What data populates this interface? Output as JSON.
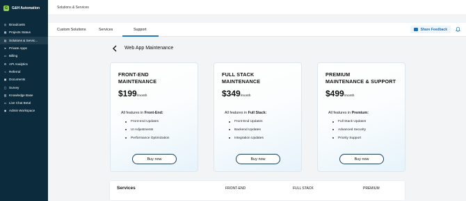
{
  "sidebar": {
    "brand": "G&H Automation",
    "brand_initial": "G",
    "items": [
      {
        "label": "Broadcasts",
        "icon": "broadcast-icon"
      },
      {
        "label": "Projects Status",
        "icon": "projects-icon"
      },
      {
        "label": "Solutions & Servic...",
        "icon": "solutions-icon"
      },
      {
        "label": "Private Apps",
        "icon": "apps-icon"
      },
      {
        "label": "Billing",
        "icon": "billing-icon"
      },
      {
        "label": "API Analytics",
        "icon": "analytics-icon"
      },
      {
        "label": "Referral",
        "icon": "referral-icon"
      },
      {
        "label": "Documents",
        "icon": "documents-icon"
      },
      {
        "label": "Survey",
        "icon": "survey-icon"
      },
      {
        "label": "Knowledge Base",
        "icon": "knowledge-icon"
      },
      {
        "label": "Live Chat Betal",
        "icon": "chat-icon"
      },
      {
        "label": "Admin Workspace",
        "icon": "admin-icon"
      }
    ]
  },
  "header": {
    "breadcrumb": "Solutions & Services"
  },
  "tabs": [
    {
      "label": "Custom Solutions"
    },
    {
      "label": "Services"
    },
    {
      "label": "Support"
    }
  ],
  "actions": {
    "share_feedback": "Share Feedback"
  },
  "page": {
    "title": "Web App Maintenance"
  },
  "cards": [
    {
      "title_line1": "FRONT-END",
      "title_line2": "MAINTENANCE",
      "price": "$199",
      "period": "/month",
      "features_prefix": "All features in ",
      "features_tier": "Front-End:",
      "features": [
        "Front-end Updates",
        "UI Adjustments",
        "Performance Optimization"
      ],
      "button": "Buy now"
    },
    {
      "title_line1": "FULL STACK",
      "title_line2": "MAINTENANCE",
      "price": "$349",
      "period": "/month",
      "features_prefix": "All features in ",
      "features_tier": "Full Stack:",
      "features": [
        "Front-End Updates",
        "Backend Updates",
        "Integration Updates"
      ],
      "button": "Buy now"
    },
    {
      "title_line1": "PREMIUM",
      "title_line2": "MAINTENANCE & SUPPORT",
      "price": "$499",
      "period": "/month",
      "features_prefix": "All features in ",
      "features_tier": "Premium:",
      "features": [
        "Full Stack Updates",
        "Advanced Security",
        "Priority Support"
      ],
      "button": "Buy now"
    }
  ],
  "compare": {
    "services": "Services",
    "col1": "FRONT-END",
    "col2": "FULL STACK",
    "col3": "PREMIUM"
  },
  "colors": {
    "sidebar": "#0c2c3e",
    "accent": "#1d7bb8",
    "brand": "#8fd14f"
  }
}
